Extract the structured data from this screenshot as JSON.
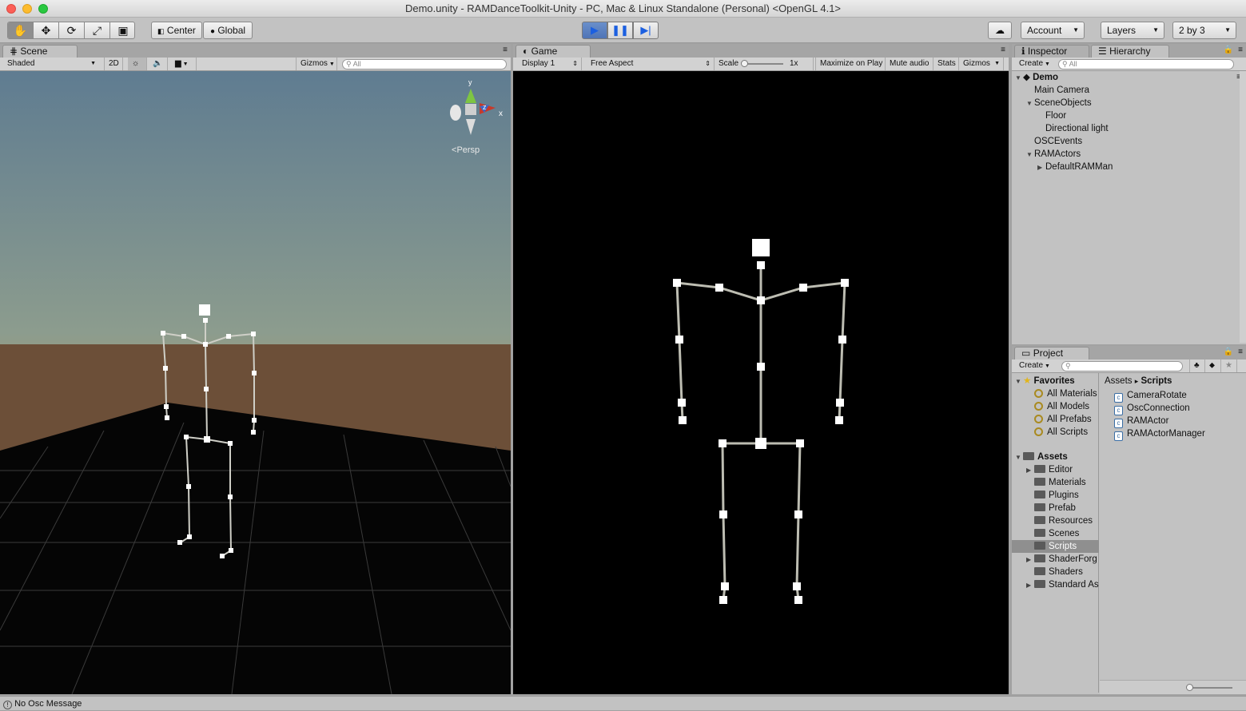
{
  "window": {
    "title": "Demo.unity - RAMDanceToolkit-Unity - PC, Mac & Linux Standalone (Personal) <OpenGL 4.1>"
  },
  "toolbar": {
    "center_label": "Center",
    "global_label": "Global",
    "account_label": "Account",
    "layers_label": "Layers",
    "layout_label": "2 by 3"
  },
  "scene": {
    "tab_label": "Scene",
    "shading_mode": "Shaded",
    "mode_2d": "2D",
    "gizmos_label": "Gizmos",
    "search_placeholder": "All",
    "persp_label": "Persp",
    "axis_y": "y",
    "axis_x": "x",
    "axis_z": "z"
  },
  "game": {
    "tab_label": "Game",
    "display": "Display 1",
    "aspect": "Free Aspect",
    "scale_label": "Scale",
    "scale_value": "1x",
    "maximize_label": "Maximize on Play",
    "mute_label": "Mute audio",
    "stats_label": "Stats",
    "gizmos_label": "Gizmos"
  },
  "inspector": {
    "tab_label": "Inspector"
  },
  "hierarchy": {
    "tab_label": "Hierarchy",
    "create_label": "Create",
    "search_placeholder": "All",
    "scene_name": "Demo",
    "items": [
      {
        "label": "Main Camera",
        "depth": 1,
        "arrow": ""
      },
      {
        "label": "SceneObjects",
        "depth": 1,
        "arrow": "expanded"
      },
      {
        "label": "Floor",
        "depth": 2,
        "arrow": ""
      },
      {
        "label": "Directional light",
        "depth": 2,
        "arrow": ""
      },
      {
        "label": "OSCEvents",
        "depth": 1,
        "arrow": ""
      },
      {
        "label": "RAMActors",
        "depth": 1,
        "arrow": "expanded"
      },
      {
        "label": "DefaultRAMMan",
        "depth": 2,
        "arrow": "collapsed"
      }
    ]
  },
  "project": {
    "tab_label": "Project",
    "create_label": "Create",
    "favorites_label": "Favorites",
    "favorites": [
      "All Materials",
      "All Models",
      "All Prefabs",
      "All Scripts"
    ],
    "assets_label": "Assets",
    "folders": [
      {
        "label": "Editor",
        "arrow": "collapsed",
        "selected": false
      },
      {
        "label": "Materials",
        "arrow": "",
        "selected": false
      },
      {
        "label": "Plugins",
        "arrow": "",
        "selected": false
      },
      {
        "label": "Prefab",
        "arrow": "",
        "selected": false
      },
      {
        "label": "Resources",
        "arrow": "",
        "selected": false
      },
      {
        "label": "Scenes",
        "arrow": "",
        "selected": false
      },
      {
        "label": "Scripts",
        "arrow": "",
        "selected": true
      },
      {
        "label": "ShaderForg",
        "arrow": "collapsed",
        "selected": false
      },
      {
        "label": "Shaders",
        "arrow": "",
        "selected": false
      },
      {
        "label": "Standard As",
        "arrow": "collapsed",
        "selected": false
      }
    ],
    "breadcrumb_root": "Assets",
    "breadcrumb_sep": "▸",
    "breadcrumb_current": "Scripts",
    "files": [
      "CameraRotate",
      "OscConnection",
      "RAMActor",
      "RAMActorManager"
    ]
  },
  "status": {
    "message": "No Osc Message"
  }
}
